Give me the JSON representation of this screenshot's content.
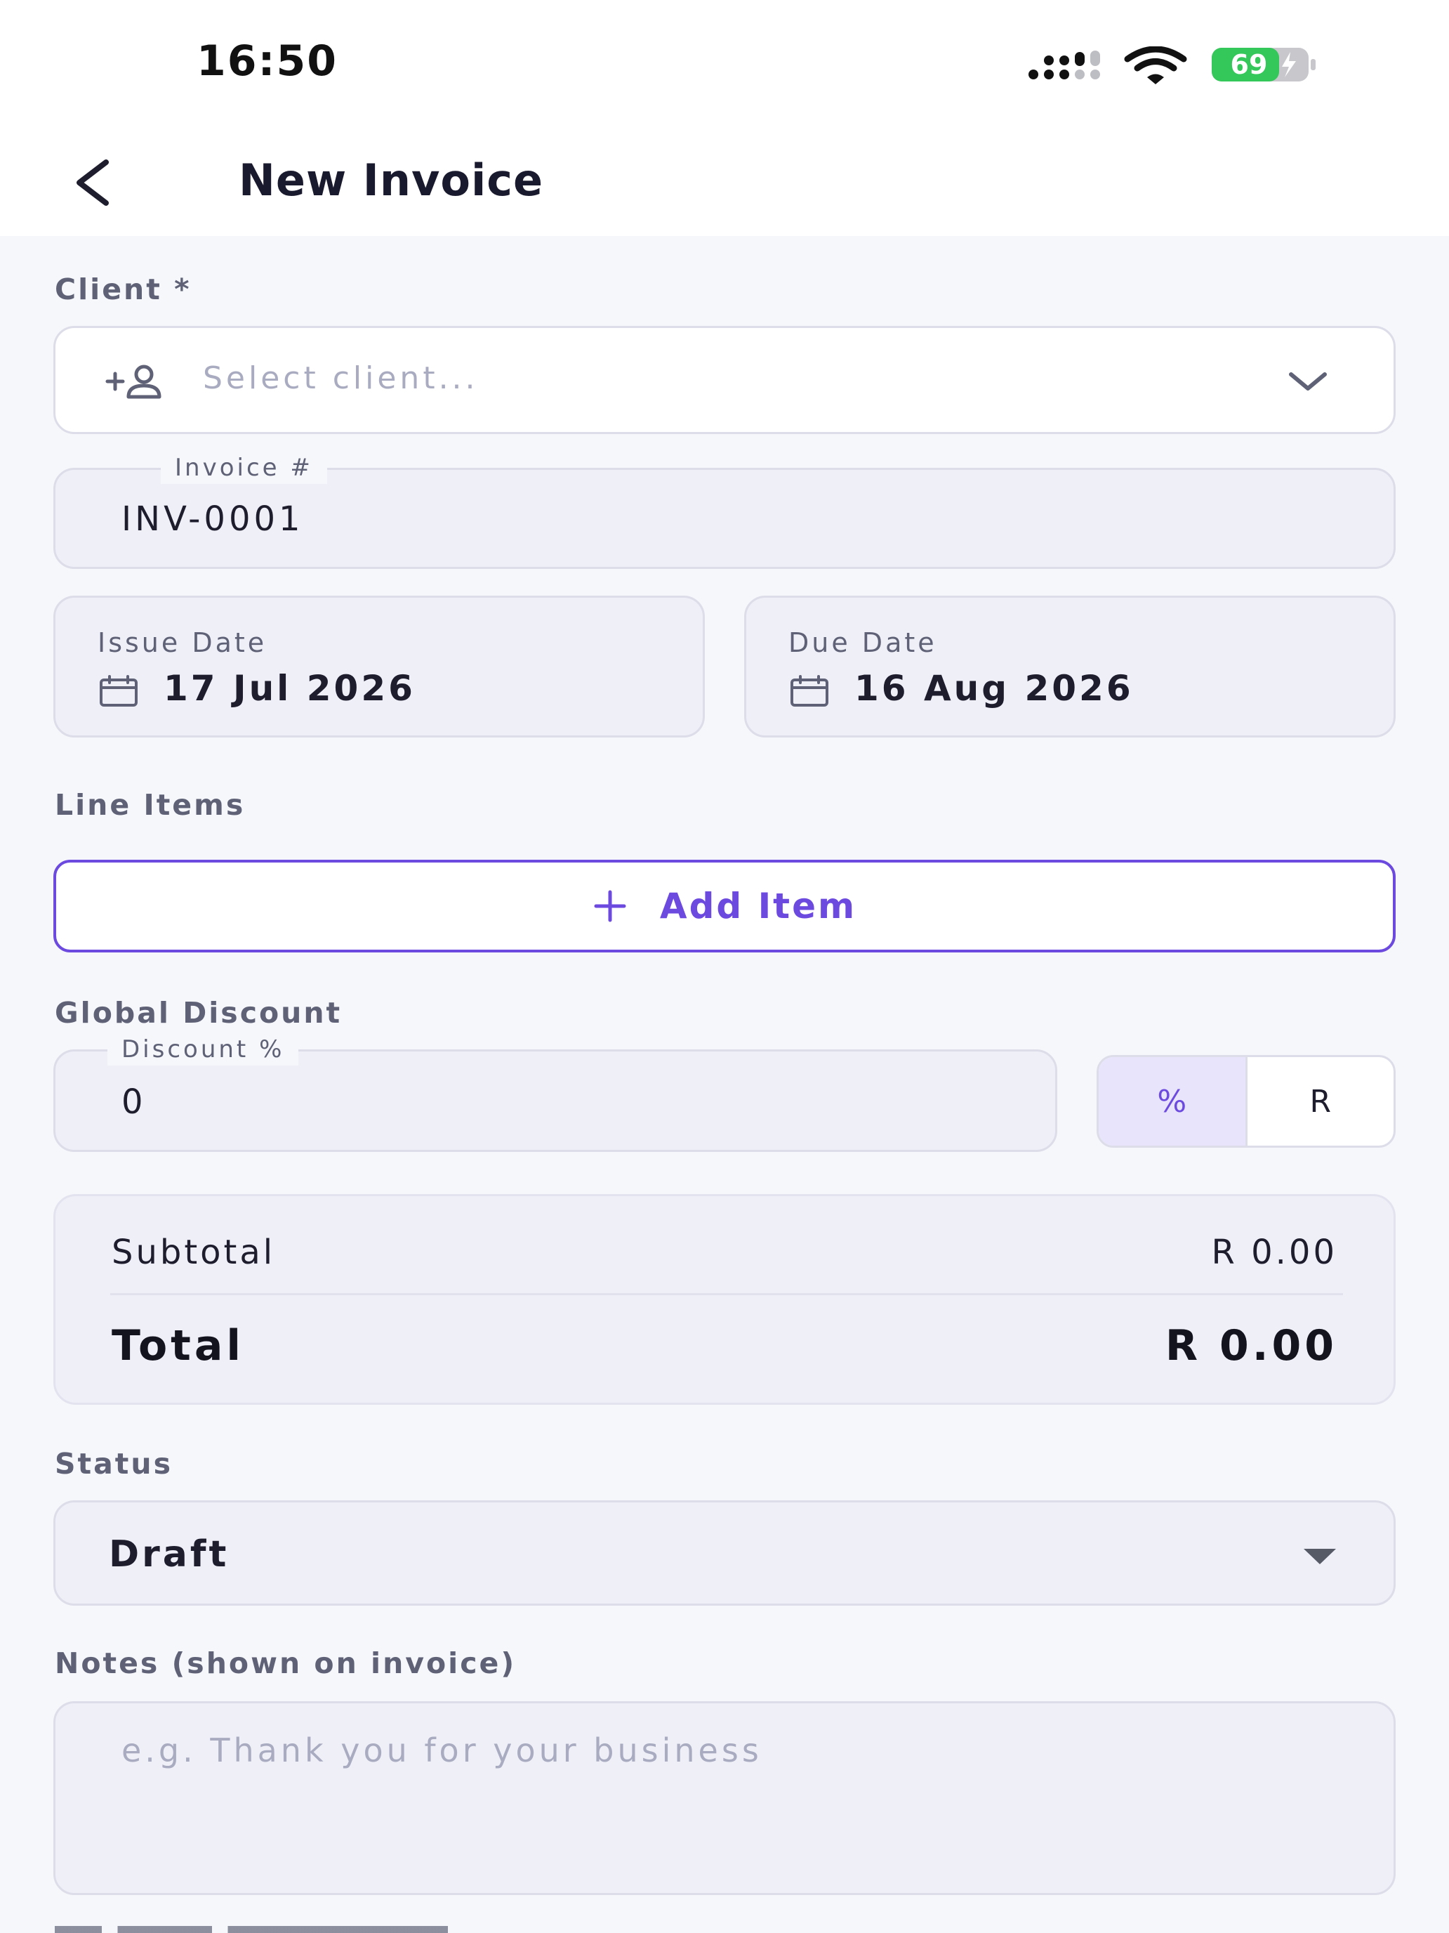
{
  "status_bar": {
    "time": "16:50",
    "battery_level": "69"
  },
  "header": {
    "title": "New Invoice"
  },
  "client": {
    "label": "Client *",
    "placeholder": "Select client..."
  },
  "invoice_number": {
    "label": "Invoice #",
    "value": "INV-0001"
  },
  "issue_date": {
    "label": "Issue Date",
    "value": "17 Jul 2026"
  },
  "due_date": {
    "label": "Due Date",
    "value": "16 Aug 2026"
  },
  "line_items": {
    "label": "Line Items",
    "add_label": "Add Item"
  },
  "global_discount": {
    "label": "Global Discount",
    "field_label": "Discount %",
    "value": "0",
    "toggle": [
      "%",
      "R"
    ],
    "selected": "%"
  },
  "totals": {
    "subtotal_label": "Subtotal",
    "subtotal_value": "R 0.00",
    "total_label": "Total",
    "total_value": "R 0.00"
  },
  "status": {
    "label": "Status",
    "value": "Draft"
  },
  "notes": {
    "label": "Notes (shown on invoice)",
    "placeholder": "e.g. Thank you for your business"
  },
  "colors": {
    "accent": "#6c4ae0",
    "battery": "#34c759"
  }
}
